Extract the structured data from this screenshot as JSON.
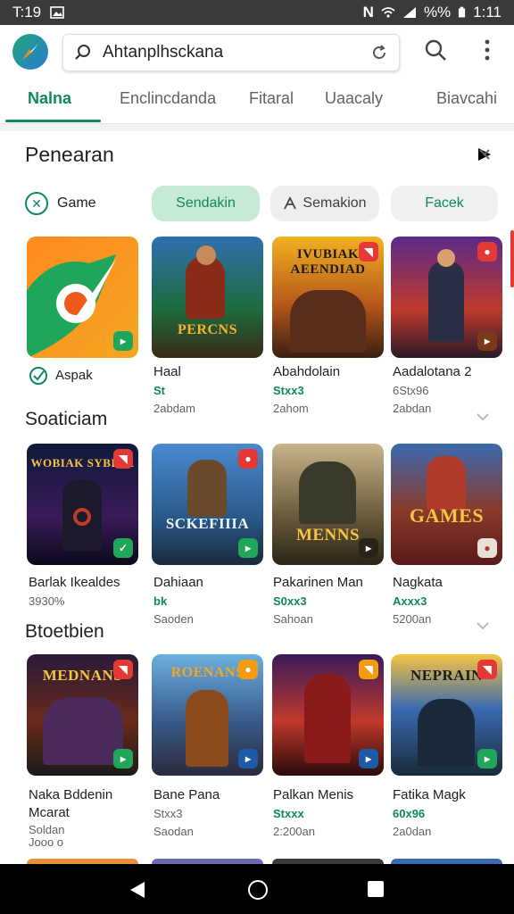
{
  "status_bar": {
    "time": "T:19",
    "battery": "%%",
    "clock": "1:11"
  },
  "search": {
    "value": "Ahtanplhsckana"
  },
  "tabs": [
    {
      "label": "Nalna",
      "active": true
    },
    {
      "label": "Enclincdanda"
    },
    {
      "label": "Fitaral"
    },
    {
      "label": "Uaacaly"
    },
    {
      "label": "Biavcahi"
    }
  ],
  "section1": {
    "title": "Penearan"
  },
  "chips": {
    "game": "Game",
    "sendakin": "Sendakin",
    "semakion": "Semakion",
    "facek": "Facek"
  },
  "row1": [
    {
      "name": "Aspak",
      "rating": "",
      "meta": "",
      "art": ""
    },
    {
      "name": "Haal",
      "rating": "St",
      "meta": "2abdam",
      "art": "PERCNS"
    },
    {
      "name": "Abahdolain",
      "rating": "Stxx3",
      "meta": "2ahom",
      "art": "IVUBIAK AEENDIAD"
    },
    {
      "name": "Aadalotana 2",
      "rating": "6Stx96",
      "meta": "2abdan",
      "art": ""
    }
  ],
  "section2": {
    "title": "Soaticiam"
  },
  "row2": [
    {
      "name": "Barlak Ikealdes",
      "rating": "",
      "meta": "3930%",
      "art": "WOBIAK SYBIAK"
    },
    {
      "name": "Dahiaan",
      "rating": "bk",
      "meta": "Saoden",
      "art": "SCKEFIIIA"
    },
    {
      "name": "Pakarinen Man",
      "rating": "S0xx3",
      "meta": "Sahoan",
      "art": "MENNS"
    },
    {
      "name": "Nagkata",
      "rating": "Axxx3",
      "meta": "5200an",
      "art": "GAMES"
    }
  ],
  "section3": {
    "title": "Btoetbien"
  },
  "row3": [
    {
      "name": "Naka Bddenin",
      "name2": "Mcarat",
      "rating": "",
      "meta": "Soldan",
      "meta2": "Jooo o",
      "art": "MEDNANS"
    },
    {
      "name": "Bane Pana",
      "rating": "Stxx3",
      "meta": "Saodan",
      "art": "ROENANS"
    },
    {
      "name": "Palkan Menis",
      "rating": "Stxxx",
      "meta": "2:200an",
      "art": ""
    },
    {
      "name": "Fatika Magk",
      "rating": "60x96",
      "meta": "2a0dan",
      "art": "NEPRAIN"
    }
  ],
  "colors": {
    "accent": "#0f8a5a",
    "accent_light": "#c7ead5",
    "nav_bg": "#000000"
  }
}
